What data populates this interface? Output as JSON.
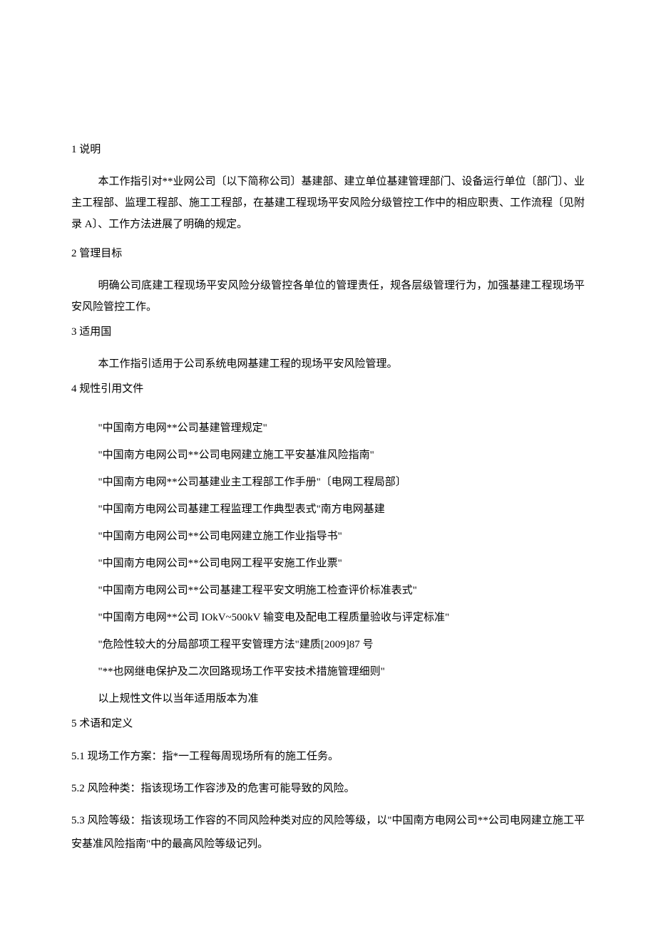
{
  "sections": {
    "s1": {
      "heading": "1 说明",
      "para": "本工作指引对**业网公司〔以下简称公司〕基建部、建立单位基建管理部门、设备运行单位〔部门〕、业主工程部、监理工程部、施工工程部，在基建工程现场平安风险分级管控工作中的相应职责、工作流程〔见附录 A〕、工作方法进展了明确的规定。"
    },
    "s2": {
      "heading": "2 管理目标",
      "para": "明确公司底建工程现场平安风险分级管控各单位的管理责任，规各层级管理行为，加强基建工程现场平安风险管控工作。"
    },
    "s3": {
      "heading": "3 适用国",
      "para": "本工作指引适用于公司系统电网基建工程的现场平安风险管理。"
    },
    "s4": {
      "heading": "4 规性引用文件",
      "refs": [
        "\"中国南方电网**公司基建管理规定\"",
        "\"中国南方电网公司**公司电网建立施工平安基准风险指南\"",
        "\"中国南方电网**公司基建业主工程部工作手册\"〔电网工程局部〕",
        "\"中国南方电网公司基建工程监理工作典型表式\"南方电网基建",
        "\"中国南方电网公司**公司电网建立施工作业指导书\"",
        "\"中国南方电网公司**公司电网工程平安施工作业票\"",
        "\"中国南方电网公司**公司基建工程平安文明施工检查评价标准表式\"",
        "\"中国南方电网**公司 IOkV~500kV 输变电及配电工程质量验收与评定标准\"",
        "\"危险性较大的分局部项工程平安管理方法\"建质[2009]87 号",
        "\"**也网继电保护及二次回路现场工作平安技术措施管理细则\""
      ],
      "note": "以上规性文件以当年适用版本为准"
    },
    "s5": {
      "heading": "5 术语和定义",
      "defs": [
        "5.1   现场工作方案：指*一工程每周现场所有的施工任务。",
        "5.2   风险种类：指该现场工作容涉及的危害可能导致的风险。",
        "5.3   风险等级：指该现场工作容的不同风险种类对应的风险等级，以\"中国南方电网公司**公司电网建立施工平安基准风险指南\"中的最高风险等级记列。"
      ]
    }
  }
}
